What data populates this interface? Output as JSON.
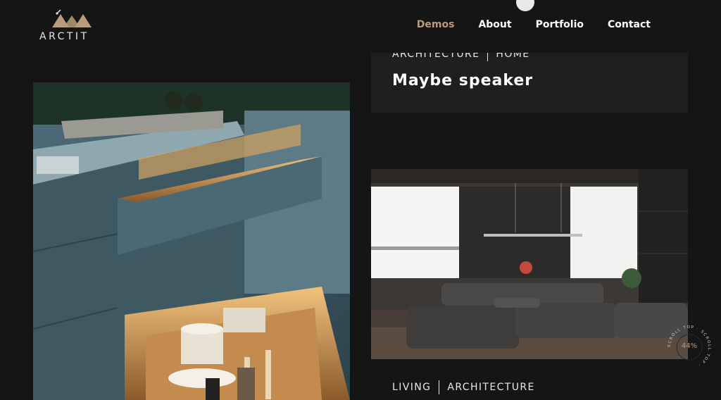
{
  "brand": {
    "name": "ARCTIT"
  },
  "nav": {
    "items": [
      "Demos",
      "About",
      "Portfolio",
      "Contact"
    ],
    "active": "Demos"
  },
  "post_top": {
    "categories": [
      "ARCHITECTURE",
      "HOME"
    ],
    "title": "Maybe speaker"
  },
  "post_bottom": {
    "categories": [
      "LIVING",
      "ARCHITECTURE"
    ]
  },
  "scroll_top": {
    "label": "SCROLL TOP",
    "percent": "44%"
  },
  "colors": {
    "accent": "#b89c7d",
    "background": "#151515",
    "card": "#1f1f1f"
  },
  "icons": [
    "logo-roof-icon",
    "scroll-top-ring-icon"
  ]
}
